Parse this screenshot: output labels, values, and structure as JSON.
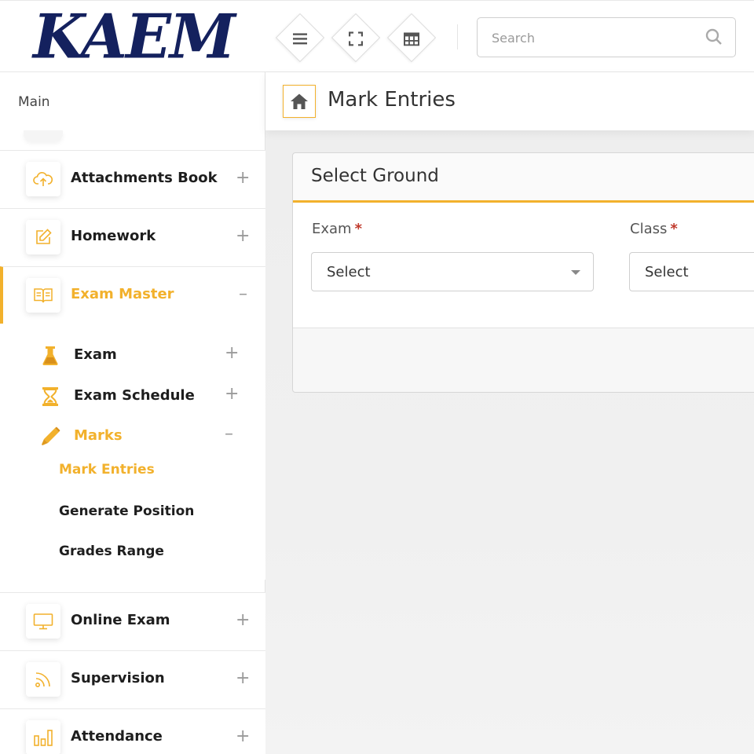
{
  "header": {
    "logo_text": "KAEM",
    "search_placeholder": "Search",
    "buttons": [
      {
        "icon": "menu-icon"
      },
      {
        "icon": "fullscreen-icon"
      },
      {
        "icon": "grid-icon"
      }
    ]
  },
  "sidebar": {
    "section_label": "Main",
    "items": [
      {
        "label": "Attachments Book",
        "icon": "cloud-upload-icon",
        "toggle": "+"
      },
      {
        "label": "Homework",
        "icon": "edit-icon",
        "toggle": "+"
      },
      {
        "label": "Exam Master",
        "icon": "book-icon",
        "toggle": "–",
        "active": true
      },
      {
        "label": "Online Exam",
        "icon": "monitor-icon",
        "toggle": "+"
      },
      {
        "label": "Supervision",
        "icon": "rss-icon",
        "toggle": "+"
      },
      {
        "label": "Attendance",
        "icon": "bar-chart-icon",
        "toggle": "+"
      }
    ],
    "exam_master_sub": [
      {
        "label": "Exam",
        "icon": "flask-icon",
        "toggle": "+"
      },
      {
        "label": "Exam Schedule",
        "icon": "hourglass-icon",
        "toggle": "+"
      },
      {
        "label": "Marks",
        "icon": "pen-icon",
        "toggle": "–",
        "active": true
      }
    ],
    "marks_sub": [
      {
        "label": "Mark Entries",
        "active": true
      },
      {
        "label": "Generate Position"
      },
      {
        "label": "Grades Range"
      }
    ]
  },
  "page": {
    "title": "Mark Entries",
    "card_title": "Select Ground",
    "fields": [
      {
        "label": "Exam",
        "required": "*",
        "value": "Select"
      },
      {
        "label": "Class",
        "required": "*",
        "value": "Select"
      }
    ]
  },
  "colors": {
    "accent": "#f2b12c",
    "logo": "#14215e"
  }
}
